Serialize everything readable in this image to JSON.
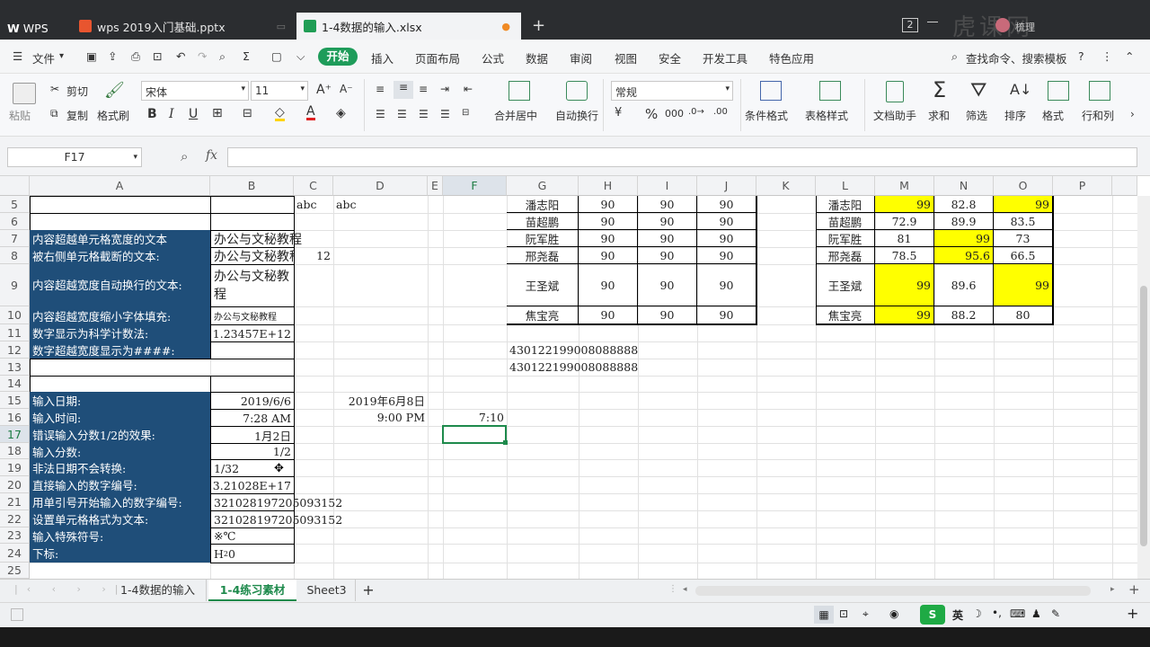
{
  "titlebar": {
    "app_label": "WPS",
    "tabs": [
      {
        "label": "wps 2019入门基础.pptx",
        "icon": "presentation-icon"
      },
      {
        "label": "1-4数据的输入.xlsx",
        "icon": "spreadsheet-icon"
      }
    ],
    "add_tab": "+",
    "badge": "2",
    "user": "梳理",
    "watermark": "虎课网"
  },
  "menubar": {
    "file": "文件",
    "items": [
      "开始",
      "插入",
      "页面布局",
      "公式",
      "数据",
      "审阅",
      "视图",
      "安全",
      "开发工具",
      "特色应用"
    ],
    "search": "查找命令、搜索模板"
  },
  "ribbon": {
    "paste": "粘贴",
    "cut": "剪切",
    "copy": "复制",
    "format_painter": "格式刷",
    "font_name": "宋体",
    "font_size": "11",
    "merge": "合并居中",
    "wrap": "自动换行",
    "number_format": "常规",
    "cond_format": "条件格式",
    "table_style": "表格样式",
    "doc_helper": "文档助手",
    "sum": "求和",
    "filter": "筛选",
    "sort": "排序",
    "format": "格式",
    "rowcol": "行和列"
  },
  "formulabar": {
    "namebox": "F17",
    "fx": "fx"
  },
  "columns": [
    "A",
    "B",
    "C",
    "D",
    "E",
    "F",
    "G",
    "H",
    "I",
    "J",
    "K",
    "L",
    "M",
    "N",
    "O",
    "P"
  ],
  "rows": [
    "5",
    "6",
    "7",
    "8",
    "9",
    "10",
    "11",
    "12",
    "13",
    "14",
    "15",
    "16",
    "17",
    "18",
    "19",
    "20",
    "21",
    "22",
    "23",
    "24",
    "25"
  ],
  "cells": {
    "c5": "abc",
    "d5": "abc",
    "a7": "内容超越单元格宽度的文本",
    "b7": "办公与文秘教程",
    "a8": "被右侧单元格截断的文本:",
    "b8": "办公与文秘教程",
    "c8": "12",
    "a9": "内容超越宽度自动换行的文本:",
    "b9": "办公与文秘教程",
    "a10": "内容超越宽度缩小字体填充:",
    "b10": "办公与文秘教程",
    "a11": "数字显示为科学计数法:",
    "b11": "1.23457E+12",
    "a12": "数字超越宽度显示为####:",
    "a15": "输入日期:",
    "b15": "2019/6/6",
    "d15": "2019年6月8日",
    "a16": "输入时间:",
    "b16": "7:28 AM",
    "d16": "9:00 PM",
    "f16": "7:10",
    "a17": "错误输入分数1/2的效果:",
    "b17": "1月2日",
    "a18": "输入分数:",
    "b18": "1/2",
    "a19": "非法日期不会转换:",
    "b19": "1/32",
    "a20": "直接输入的数字编号:",
    "b20": "3.21028E+17",
    "a21": "用单引号开始输入的数字编号:",
    "b21": "321028197205093152",
    "a22": "设置单元格格式为文本:",
    "b22": "321028197205093152",
    "a23": "输入特殊符号:",
    "b23": "※℃",
    "a24": "下标:",
    "b24_main": "H",
    "b24_sub": "2",
    "b24_tail": "0",
    "g11": "430122199008088888",
    "g12": "430122199008088888"
  },
  "table_ghij": [
    {
      "name": "潘志阳",
      "h": "90",
      "i": "90",
      "j": "90"
    },
    {
      "name": "苗超鹏",
      "h": "90",
      "i": "90",
      "j": "90"
    },
    {
      "name": "阮军胜",
      "h": "90",
      "i": "90",
      "j": "90"
    },
    {
      "name": "邢尧磊",
      "h": "90",
      "i": "90",
      "j": "90"
    },
    {
      "name": "王圣斌",
      "h": "90",
      "i": "90",
      "j": "90"
    },
    {
      "name": "焦宝亮",
      "h": "90",
      "i": "90",
      "j": "90"
    }
  ],
  "table_lmno": [
    {
      "name": "潘志阳",
      "m": "99",
      "n": "82.8",
      "o": "99"
    },
    {
      "name": "苗超鹏",
      "m": "72.9",
      "n": "89.9",
      "o": "83.5"
    },
    {
      "name": "阮军胜",
      "m": "81",
      "n": "99",
      "o": "73"
    },
    {
      "name": "邢尧磊",
      "m": "78.5",
      "n": "95.6",
      "o": "66.5"
    },
    {
      "name": "王圣斌",
      "m": "99",
      "n": "89.6",
      "o": "99"
    },
    {
      "name": "焦宝亮",
      "m": "99",
      "n": "88.2",
      "o": "80"
    }
  ],
  "sheets": [
    "1-4数据的输入",
    "1-4练习素材",
    "Sheet3"
  ],
  "status": {
    "ime": "英"
  }
}
